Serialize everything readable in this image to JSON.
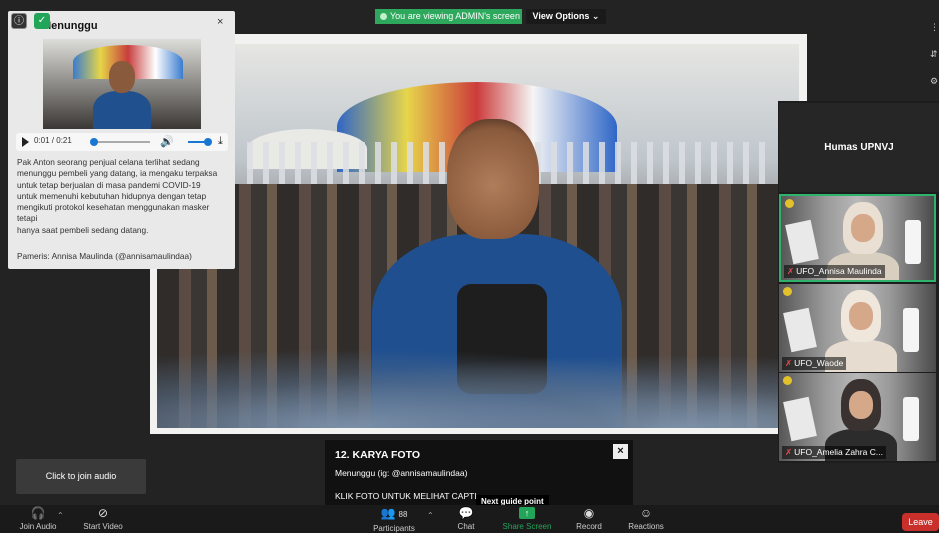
{
  "banner": {
    "viewing": "You are viewing ADMIN's screen",
    "view_options": "View Options ⌄"
  },
  "card": {
    "title": "Menunggu",
    "close": "×",
    "audio_time": "0:01 / 0:21",
    "description": "Pak Anton seorang penjual celana terlihat sedang\nmenunggu pembeli yang datang, ia mengaku terpaksa\nuntuk tetap berjualan di masa pandemi COVID-19\nuntuk memenuhi kebutuhan hidupnya dengan tetap\nmengikuti protokol kesehatan menggunakan masker\ntetapi\nhanya saat pembeli sedang datang.",
    "credit": "Pameris: Annisa Maulinda (@annisamaulindaa)"
  },
  "panel": {
    "host_tile": "Humas UPNVJ",
    "participants": [
      {
        "name": "UFO_Annisa Maulinda",
        "active": true
      },
      {
        "name": "UFO_Waode",
        "active": false
      },
      {
        "name": "UFO_Amelia Zahra C...",
        "active": false
      }
    ]
  },
  "caption": {
    "title": "12. KARYA FOTO",
    "subtitle": "Menunggu (ig: @annisamaulindaa)",
    "cta": "KLIK FOTO UNTUK MELIHAT CAPTI",
    "close": "×",
    "guide_tip": "Next guide point"
  },
  "join_audio_overlay": "Click to join audio",
  "toolbar": {
    "join_audio": "Join Audio",
    "start_video": "Start Video",
    "participants": "Participants",
    "participants_count": "88",
    "chat": "Chat",
    "share_screen": "Share Screen",
    "record": "Record",
    "reactions": "Reactions",
    "leave": "Leave"
  },
  "colors": {
    "share_green": "#23a559",
    "leave_red": "#c9302c",
    "active_border": "#2db36b"
  }
}
